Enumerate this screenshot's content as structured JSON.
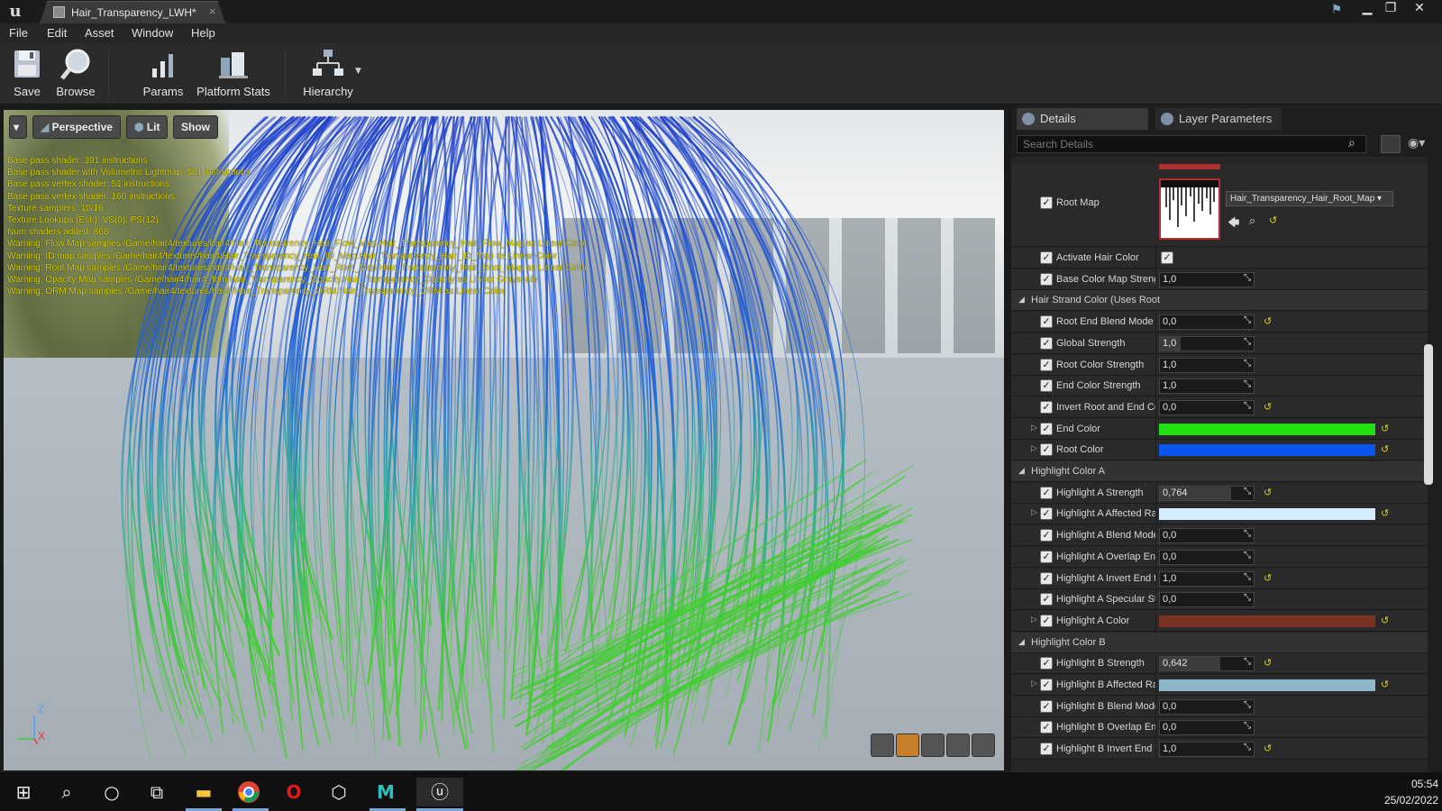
{
  "window": {
    "title": "Hair_Transparency_LWH*"
  },
  "menu": [
    "File",
    "Edit",
    "Asset",
    "Window",
    "Help"
  ],
  "toolbar": {
    "save": "Save",
    "browse": "Browse",
    "params": "Params",
    "platform_stats": "Platform Stats",
    "hierarchy": "Hierarchy"
  },
  "viewport": {
    "perspective": "Perspective",
    "lit": "Lit",
    "show": "Show",
    "stats": [
      "Base pass shader: 391 instructions",
      "Base pass shader with Volumetric Lightmap: 581 instructions",
      "Base pass vertex shader: 51 instructions",
      "Base pass vertex shader: 160 instructions",
      "Texture samplers: 10/16",
      "Texture Lookups (Est.): VS(0), PS(12)",
      "Num shaders added: 868",
      "Warning: Flow Map samples /Game/hair4/textures/hair4/Hair_Transparency_Hair_Flow_Map.Hair_Transparency_Hair_Flow_Map as Linear Color",
      "Warning: ID map samples /Game/hair4/textures/hair4/Hair_Transparency_Hair_ID_Map.Hair_Transparency_Hair_ID_Map as Linear Color",
      "Warning: Root Map samples /Game/hair4/textures/hair4/Hair_Transparency_Hair_Root_Map.Hair_Transparency_Hair_Root_Map as Linear Color",
      "Warning: Opacity Map samples /Game/hair4/hair4_fbm/Hair_Transparency_Opacity.Hair_Transparency_Opacity as Linear Grayscale",
      "Warning: ORM Map samples /Game/hair4/textures/hair4/Hair_Transparency_ORM.Hair_Transparency_ORM as Linear Color"
    ],
    "axis_z": "Z",
    "axis_x": "X"
  },
  "panel": {
    "tab_details": "Details",
    "tab_layer": "Layer Parameters",
    "search_placeholder": "Search Details",
    "root_map": {
      "label": "Root Map",
      "texture": "Hair_Transparency_Hair_Root_Map"
    },
    "rows": [
      {
        "kind": "bool",
        "label": "Activate Hair Color",
        "checked": true
      },
      {
        "kind": "num",
        "label": "Base Color Map Streng",
        "value": "1,0",
        "reset": false
      },
      {
        "kind": "cat",
        "label": "Hair Strand Color (Uses Root"
      },
      {
        "kind": "num",
        "label": "Root End Blend Mode",
        "value": "0,0",
        "reset": true
      },
      {
        "kind": "num",
        "label": "Global Strength",
        "value": "1,0",
        "reset": false,
        "fill": 0.22
      },
      {
        "kind": "num",
        "label": "Root Color Strength",
        "value": "1,0",
        "reset": false
      },
      {
        "kind": "num",
        "label": "End Color Strength",
        "value": "1,0",
        "reset": false
      },
      {
        "kind": "num",
        "label": "Invert Root and End Col",
        "value": "0,0",
        "reset": true
      },
      {
        "kind": "color",
        "label": "End Color",
        "color": "#22e010"
      },
      {
        "kind": "color",
        "label": "Root Color",
        "color": "#0a55ee"
      },
      {
        "kind": "cat",
        "label": "Highlight Color A"
      },
      {
        "kind": "num",
        "label": "Highlight A Strength",
        "value": "0,764",
        "reset": true,
        "fill": 0.764
      },
      {
        "kind": "color",
        "label": "Highlight A Affected Ra",
        "color": "#d4ecff"
      },
      {
        "kind": "num",
        "label": "Highlight A Blend Mode",
        "value": "0,0",
        "reset": false
      },
      {
        "kind": "num",
        "label": "Highlight A Overlap End",
        "value": "0,0",
        "reset": false
      },
      {
        "kind": "num",
        "label": "Highlight A Invert End to",
        "value": "1,0",
        "reset": true
      },
      {
        "kind": "num",
        "label": "Highlight A Specular Str",
        "value": "0,0",
        "reset": false
      },
      {
        "kind": "color",
        "label": "Highlight A Color",
        "color": "#7a3322"
      },
      {
        "kind": "cat",
        "label": "Highlight Color B"
      },
      {
        "kind": "num",
        "label": "Highlight B Strength",
        "value": "0,642",
        "reset": true,
        "fill": 0.642
      },
      {
        "kind": "color",
        "label": "Highlight B Affected Ra",
        "color": "#8fb7cc"
      },
      {
        "kind": "num",
        "label": "Highlight B Blend Mode",
        "value": "0,0",
        "reset": false
      },
      {
        "kind": "num",
        "label": "Highlight B Overlap End",
        "value": "0,0",
        "reset": false
      },
      {
        "kind": "num",
        "label": "Highlight B Invert End to",
        "value": "1,0",
        "reset": true
      }
    ]
  },
  "taskbar": {
    "time": "05:54",
    "date": "25/02/2022"
  }
}
